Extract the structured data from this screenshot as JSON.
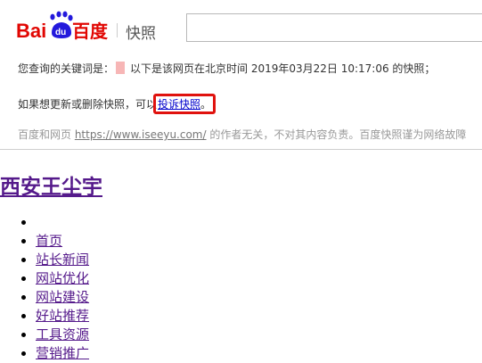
{
  "header": {
    "logo_text": "Bai百度",
    "logo_subtitle": "快照",
    "search_value": ""
  },
  "notice": {
    "keywords_label": "您查询的关键词是：",
    "snapshot_info": "以下是该网页在北京时间 2019年03月22日 10:17:06 的快照；",
    "update_prompt": "如果想更新或删除快照，可以",
    "report_link": "投诉快照",
    "report_suffix": "。"
  },
  "disclaimer": {
    "prefix": "百度和网页 ",
    "url": "https://www.iseeyu.com/",
    "suffix": " 的作者无关，不对其内容负责。百度快照谨为网络故障"
  },
  "page": {
    "site_title": "西安王尘宇",
    "nav_items": [
      "",
      "首页",
      "站长新闻",
      "网站优化",
      "网站建设",
      "好站推荐",
      "工具资源",
      "营销推广"
    ]
  },
  "colors": {
    "baidu_red": "#e10602",
    "baidu_blue": "#2319dc",
    "highlight_border": "#e0120e",
    "visited_link": "#551a8b"
  }
}
